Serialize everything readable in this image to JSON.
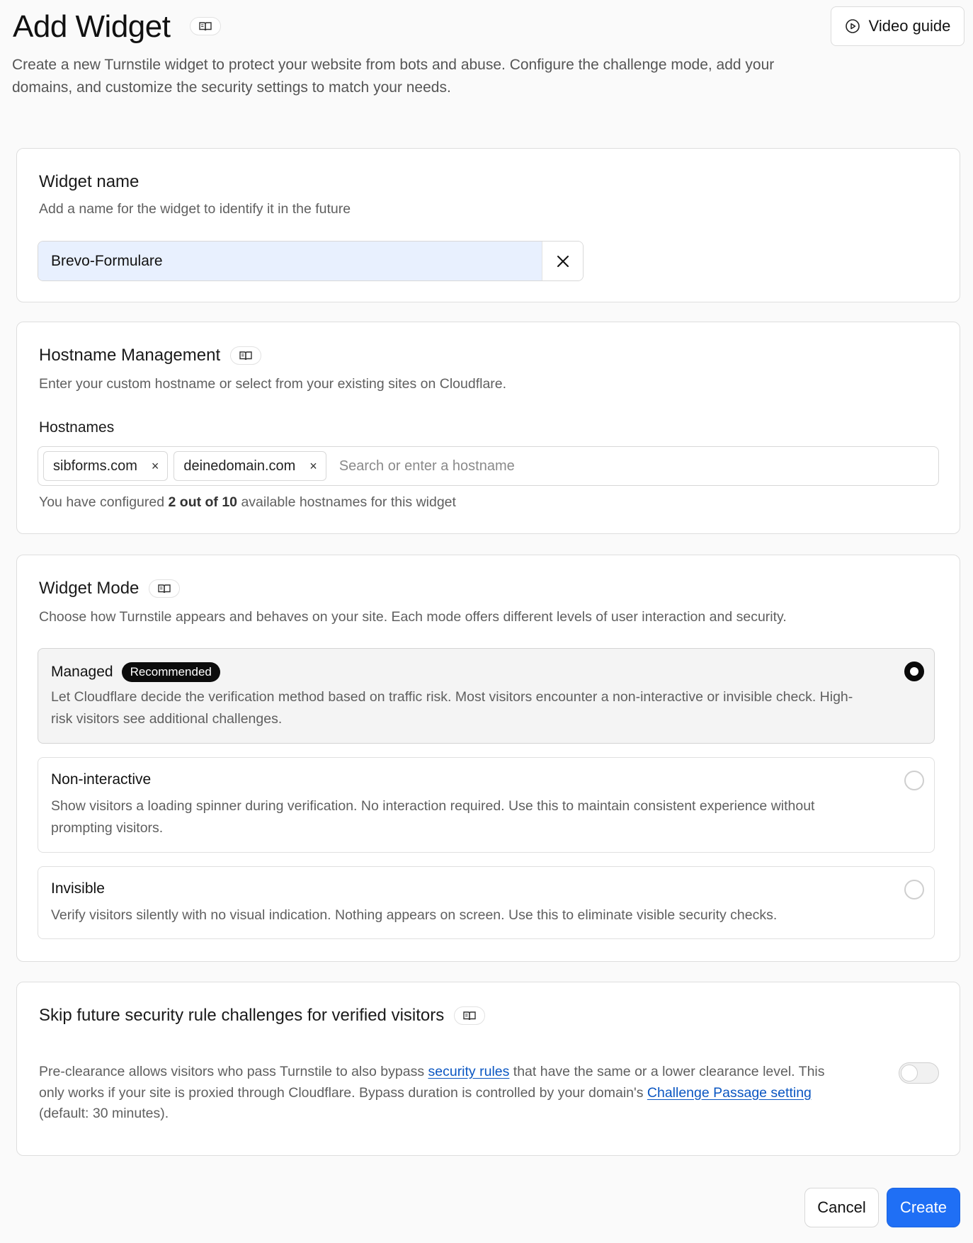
{
  "header": {
    "title": "Add Widget",
    "description": "Create a new Turnstile widget to protect your website from bots and abuse. Configure the challenge mode, add your domains, and customize the security settings to match your needs.",
    "video_guide_label": "Video guide"
  },
  "widget_name": {
    "title": "Widget name",
    "subtitle": "Add a name for the widget to identify it in the future",
    "value": "Brevo-Formulare"
  },
  "hostname_management": {
    "title": "Hostname Management",
    "subtitle": "Enter your custom hostname or select from your existing sites on Cloudflare.",
    "label": "Hostnames",
    "chips": [
      "sibforms.com",
      "deinedomain.com"
    ],
    "placeholder": "Search or enter a hostname",
    "note_prefix": "You have configured ",
    "note_count": "2 out of 10",
    "note_suffix": " available hostnames for this widget"
  },
  "widget_mode": {
    "title": "Widget Mode",
    "subtitle": "Choose how Turnstile appears and behaves on your site. Each mode offers different levels of user interaction and security.",
    "options": [
      {
        "title": "Managed",
        "badge": "Recommended",
        "description": "Let Cloudflare decide the verification method based on traffic risk. Most visitors encounter a non-interactive or invisible check. High-risk visitors see additional challenges.",
        "selected": true
      },
      {
        "title": "Non-interactive",
        "description": "Show visitors a loading spinner during verification. No interaction required. Use this to maintain consistent experience without prompting visitors.",
        "selected": false
      },
      {
        "title": "Invisible",
        "description": "Verify visitors silently with no visual indication. Nothing appears on screen. Use this to eliminate visible security checks.",
        "selected": false
      }
    ]
  },
  "pre_clearance": {
    "title": "Skip future security rule challenges for verified visitors",
    "text_1": "Pre-clearance allows visitors who pass Turnstile to also bypass ",
    "link_1": "security rules",
    "text_2": " that have the same or a lower clearance level. This only works if your site is proxied through Cloudflare. Bypass duration is controlled by your domain's ",
    "link_2": "Challenge Passage setting",
    "text_3": " (default: 30 minutes).",
    "enabled": false
  },
  "footer": {
    "cancel_label": "Cancel",
    "create_label": "Create"
  },
  "icons": {
    "docs": "book-icon",
    "video": "play-circle-icon",
    "clear": "close-icon",
    "chip_remove": "×"
  },
  "colors": {
    "primary": "#1f6ff5",
    "link": "#0a56c2",
    "autofill": "#e8f0fe"
  }
}
